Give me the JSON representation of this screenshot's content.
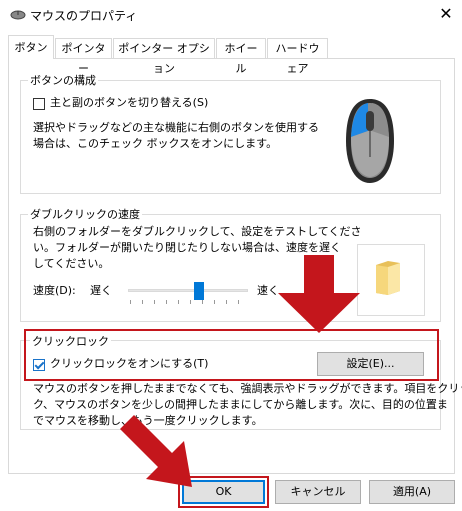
{
  "window": {
    "title": "マウスのプロパティ",
    "close_glyph": "✕"
  },
  "tabs": [
    {
      "label": "ボタン",
      "active": true
    },
    {
      "label": "ポインター",
      "active": false
    },
    {
      "label": "ポインター オプション",
      "active": false
    },
    {
      "label": "ホイール",
      "active": false
    },
    {
      "label": "ハードウェア",
      "active": false
    }
  ],
  "button_config": {
    "group_title": "ボタンの構成",
    "swap_label": "主と副のボタンを切り替える(S)",
    "swap_checked": false,
    "description_line1": "選択やドラッグなどの主な機能に右側のボタンを使用する",
    "description_line2": "場合は、このチェック ボックスをオンにします。"
  },
  "double_click": {
    "group_title": "ダブルクリックの速度",
    "description_line1": "右側のフォルダーをダブルクリックして、設定をテストしてくださ",
    "description_line2": "い。フォルダーが開いたり閉じたりしない場合は、速度を遅く",
    "description_line3": "してください。",
    "speed_label": "速度(D):",
    "slow_label": "遅く",
    "fast_label": "速く",
    "speed_value": 0.6
  },
  "click_lock": {
    "group_title": "クリックロック",
    "checkbox_label": "クリックロックをオンにする(T)",
    "checked": true,
    "settings_button": "設定(E)...",
    "description_line1": "マウスのボタンを押したままでなくても、強調表示やドラッグができます。項目をクリッ",
    "description_line2": "ク、マウスのボタンを少しの間押したままにしてから離します。次に、目的の位置ま",
    "description_line3": "でマウスを移動し、もう一度クリックします。"
  },
  "footer": {
    "ok_label": "OK",
    "cancel_label": "キャンセル",
    "apply_label": "適用(A)"
  },
  "colors": {
    "accent": "#0078d7",
    "annotation_red": "#c4161c"
  }
}
